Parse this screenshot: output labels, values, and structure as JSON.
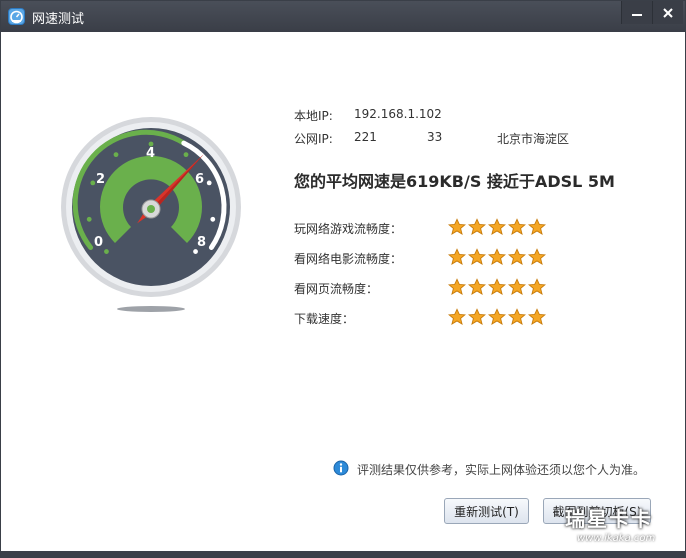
{
  "window": {
    "title": "网速测试"
  },
  "gauge": {
    "ticks": [
      "0",
      "2",
      "4",
      "6",
      "8"
    ],
    "needle_value": 5.3,
    "accent_green": "#6ab04c",
    "face_color": "#4a5363",
    "needle_color": "#d9342b"
  },
  "info": {
    "local_ip_label": "本地IP:",
    "local_ip_value": "192.168.1.102",
    "public_ip_label": "公网IP:",
    "public_ip_prefix": "221",
    "public_ip_suffix": "33",
    "location": "北京市海淀区"
  },
  "headline": "您的平均网速是619KB/S 接近于ADSL 5M",
  "ratings": [
    {
      "label": "玩网络游戏流畅度：",
      "stars": 5
    },
    {
      "label": "看网络电影流畅度：",
      "stars": 5
    },
    {
      "label": "看网页流畅度：",
      "stars": 5
    },
    {
      "label": "下载速度：",
      "stars": 5
    }
  ],
  "note": {
    "icon": "info-icon",
    "text": "评测结果仅供参考，实际上网体验还须以您个人为准。"
  },
  "buttons": {
    "retest": "重新测试(T)",
    "capture": "截图到剪切板(S)"
  },
  "watermark": {
    "brand": "瑞星卡卡",
    "url": "www.ikaka.com"
  }
}
